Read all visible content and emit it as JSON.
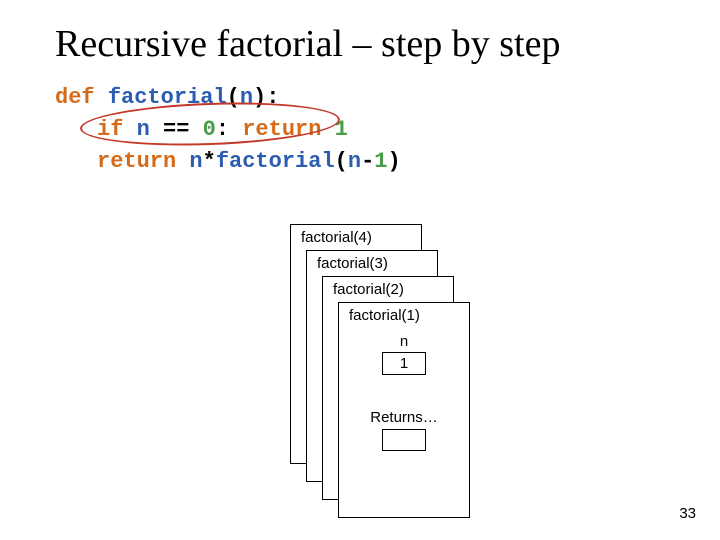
{
  "title": "Recursive factorial – step by step",
  "code": {
    "l1": {
      "def": "def",
      "fn": "factorial",
      "p1": "(",
      "n": "n",
      "p2": "):"
    },
    "l2": {
      "if": "if",
      "sp": " ",
      "n": "n",
      "eq": " == ",
      "zero": "0",
      "colon": ": ",
      "ret": "return",
      "sp2": " ",
      "one": "1"
    },
    "l3": {
      "ret": "return",
      "sp": " ",
      "n": "n",
      "star": "*",
      "fn": "factorial",
      "p1": "(",
      "n2": "n",
      "minus": "-",
      "one": "1",
      "p2": ")"
    }
  },
  "frames": {
    "f4": "factorial(4)",
    "f3": "factorial(3)",
    "f2": "factorial(2)",
    "f1": "factorial(1)"
  },
  "innermost": {
    "n_label": "n",
    "n_value": "1",
    "returns_label": "Returns…"
  },
  "page": "33"
}
